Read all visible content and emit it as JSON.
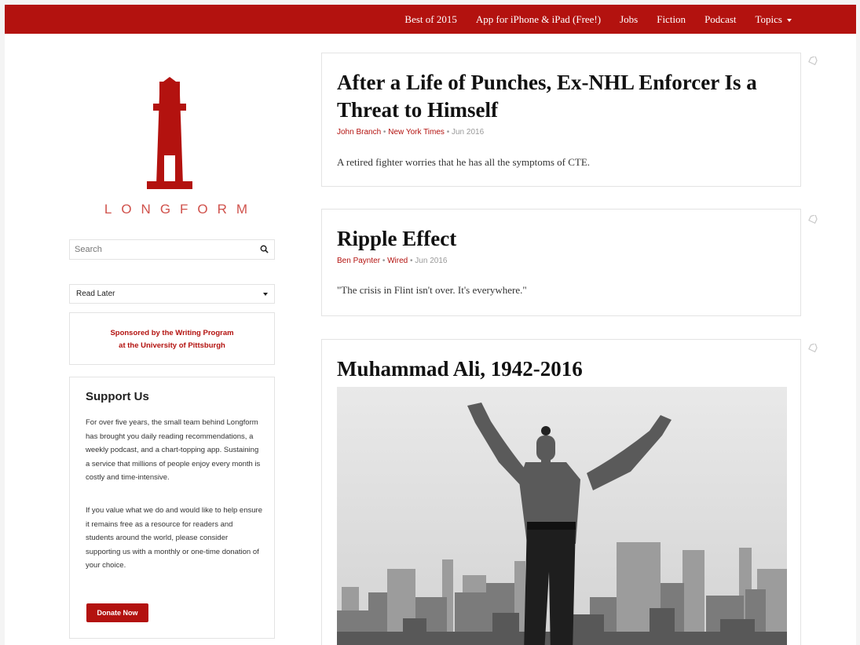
{
  "nav": {
    "items": [
      "Best of 2015",
      "App for iPhone & iPad (Free!)",
      "Jobs",
      "Fiction",
      "Podcast"
    ],
    "topics_label": "Topics",
    "icons": {
      "caret": "caret-down-icon"
    }
  },
  "brand": {
    "wordmark": "LONGFORM",
    "logo_icon": "lighthouse-logo",
    "color": "#b3120f"
  },
  "search": {
    "placeholder": "Search",
    "value": "",
    "icon": "search-icon"
  },
  "read_later": {
    "selected": "Read Later"
  },
  "sponsor": {
    "line1": "Sponsored by the Writing Program",
    "line2": "at the University of Pittsburgh"
  },
  "support": {
    "title": "Support Us",
    "para1": "For over five years, the small team behind Longform has brought you daily reading recommendations, a weekly podcast, and a chart-topping app. Sustaining a service that millions of people enjoy every month is costly and time-intensive.",
    "para2": "If you value what we do and would like to help ensure it remains free as a resource for readers and students around the world, please consider supporting us with a monthly or one-time donation of your choice.",
    "donate_label": "Donate Now"
  },
  "articles": [
    {
      "title": "After a Life of Punches, Ex-NHL Enforcer Is a Threat to Himself",
      "author": "John Branch",
      "publication": "New York Times",
      "date": "Jun 2016",
      "blurb": "A retired fighter worries that he has all the symptoms of CTE."
    },
    {
      "title": "Ripple Effect",
      "author": "Ben Paynter",
      "publication": "Wired",
      "date": "Jun 2016",
      "blurb": "\"The crisis in Flint isn't over. It's everywhere.\""
    },
    {
      "title": "Muhammad Ali, 1942-2016",
      "image": "boxer-jumping-city-skyline-photo"
    }
  ],
  "byline_separator": " • "
}
